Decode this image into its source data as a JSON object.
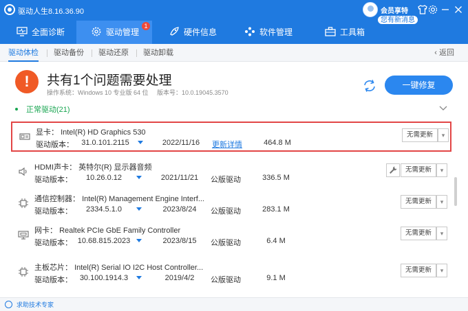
{
  "app": {
    "title": "驱动人生8.16.36.90",
    "vip_label": "会员享特权",
    "message_badge": "您有新消息"
  },
  "nav": {
    "tabs": [
      {
        "label": "全面诊断",
        "icon": "monitor-icon"
      },
      {
        "label": "驱动管理",
        "icon": "gear-icon",
        "badge": "1",
        "active": true
      },
      {
        "label": "硬件信息",
        "icon": "rocket-icon"
      },
      {
        "label": "软件管理",
        "icon": "apps-icon"
      },
      {
        "label": "工具箱",
        "icon": "toolbox-icon"
      }
    ]
  },
  "subnav": {
    "tabs": [
      {
        "label": "驱动体检",
        "active": true
      },
      {
        "label": "驱动备份"
      },
      {
        "label": "驱动还原"
      },
      {
        "label": "驱动卸载"
      }
    ],
    "back_label": "返回"
  },
  "summary": {
    "title": "共有1个问题需要处理",
    "os_info": "操作系统：Windows 10 专业版 64 位     版本号：10.0.19045.3570",
    "fix_label": "一键修复"
  },
  "section": {
    "label": "正常驱动(21)"
  },
  "version_label": "驱动版本：",
  "devices": [
    {
      "category": "显卡：",
      "name": "Intel(R) HD Graphics 530",
      "version": "31.0.101.2115",
      "date": "2022/11/16",
      "extra": "更新详情",
      "extra_is_link": true,
      "size": "464.8 M",
      "action": "无需更新",
      "highlighted": true,
      "icon": "display-card-icon"
    },
    {
      "category": "HDMI声卡：",
      "name": "英特尔(R) 显示器音频",
      "version": "10.26.0.12",
      "date": "2021/11/21",
      "extra": "公版驱动",
      "size": "336.5 M",
      "action": "无需更新",
      "wrench": true,
      "icon": "speaker-icon"
    },
    {
      "category": "通信控制器：",
      "name": "Intel(R) Management Engine Interf...",
      "version": "2334.5.1.0",
      "date": "2023/8/24",
      "extra": "公版驱动",
      "size": "283.1 M",
      "action": "无需更新",
      "icon": "chip-icon"
    },
    {
      "category": "网卡：",
      "name": "Realtek PCIe GbE Family Controller",
      "version": "10.68.815.2023",
      "date": "2023/8/15",
      "extra": "公版驱动",
      "size": "6.4 M",
      "action": "无需更新",
      "icon": "network-card-icon"
    },
    {
      "category": "主板芯片：",
      "name": "Intel(R) Serial IO I2C Host Controller...",
      "version": "30.100.1914.3",
      "date": "2019/4/2",
      "extra": "公版驱动",
      "size": "9.1 M",
      "action": "无需更新",
      "icon": "chip-icon"
    }
  ],
  "footer": {
    "label": "求助技术专家"
  }
}
